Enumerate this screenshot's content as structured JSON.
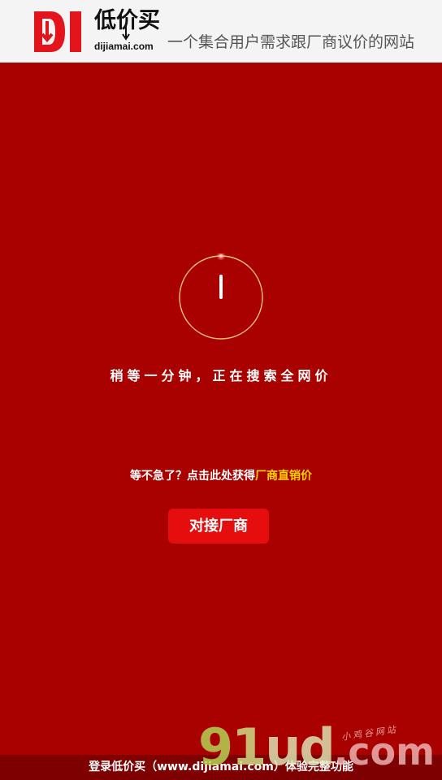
{
  "header": {
    "logo_letters": "DI",
    "logo_cn": "低价买",
    "logo_domain": "dijiamai.com",
    "tagline": "一个集合用户需求跟厂商议价的网站"
  },
  "loading": {
    "message": "稍等一分钟，正在搜索全网价"
  },
  "prompt": {
    "text": "等不急了？点击此处获得",
    "link_text": "厂商直销价"
  },
  "connect_button": {
    "label": "对接厂商"
  },
  "footer": {
    "text": "登录低价买（www.dijiamai.com）体验完整功能"
  },
  "watermark": {
    "main_a": "9",
    "main_b": "1",
    "main_c": "ud",
    "main_dot": ".com",
    "sub": "小鸡谷网站"
  },
  "colors": {
    "background": "#a90000",
    "header_bg": "#f4f4f4",
    "brand_red": "#e50d0d",
    "highlight": "#ffd400",
    "footer_bg": "#7e0000"
  }
}
